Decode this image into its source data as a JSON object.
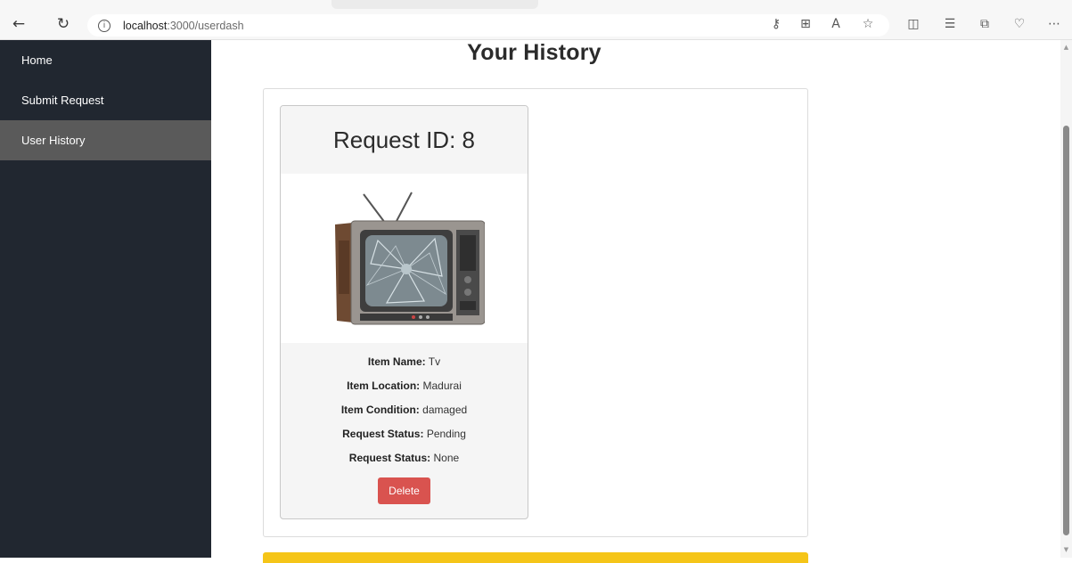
{
  "browser": {
    "url_host": "localhost",
    "url_path": ":3000/userdash"
  },
  "sidebar": {
    "items": [
      {
        "label": "Home"
      },
      {
        "label": "Submit Request"
      },
      {
        "label": "User History"
      }
    ]
  },
  "main": {
    "title": "Your History",
    "card": {
      "header": "Request ID: 8",
      "image_description": "tv-with-broken-screen",
      "fields": [
        {
          "label": "Item Name:",
          "value": "Tv"
        },
        {
          "label": "Item Location:",
          "value": "Madurai"
        },
        {
          "label": "Item Condition:",
          "value": "damaged"
        },
        {
          "label": "Request Status:",
          "value": "Pending"
        },
        {
          "label": "Request Status:",
          "value": "None"
        }
      ],
      "delete_label": "Delete"
    }
  },
  "colors": {
    "sidebar_bg": "#212730",
    "sidebar_active": "#5a5a5a",
    "delete_button": "#d9534f",
    "accent_bar": "#f5c518"
  }
}
